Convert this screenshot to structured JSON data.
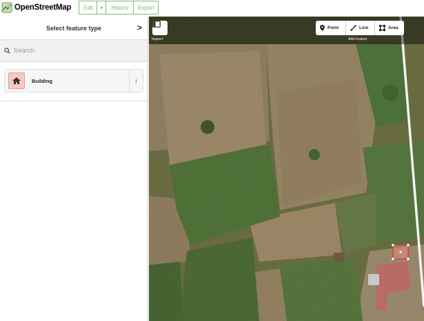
{
  "app": {
    "logo_text": "OpenStreetMap",
    "brand_color": "#7ebc6f"
  },
  "nav": {
    "edit_label": "Edit",
    "caret_label": "▾",
    "history_label": "History",
    "export_label": "Export"
  },
  "sidebar": {
    "title": "Select feature type",
    "close_glyph": ">",
    "search_placeholder": "Search",
    "presets": [
      {
        "label": "Building",
        "icon": "house-icon",
        "info_glyph": "i"
      }
    ]
  },
  "map": {
    "inspect_label": "Inspect",
    "add_feature_label": "Add Feature",
    "buttons": [
      {
        "label": "Point",
        "icon": "point-pin-icon"
      },
      {
        "label": "Line",
        "icon": "line-icon"
      },
      {
        "label": "Area",
        "icon": "area-icon"
      }
    ]
  }
}
